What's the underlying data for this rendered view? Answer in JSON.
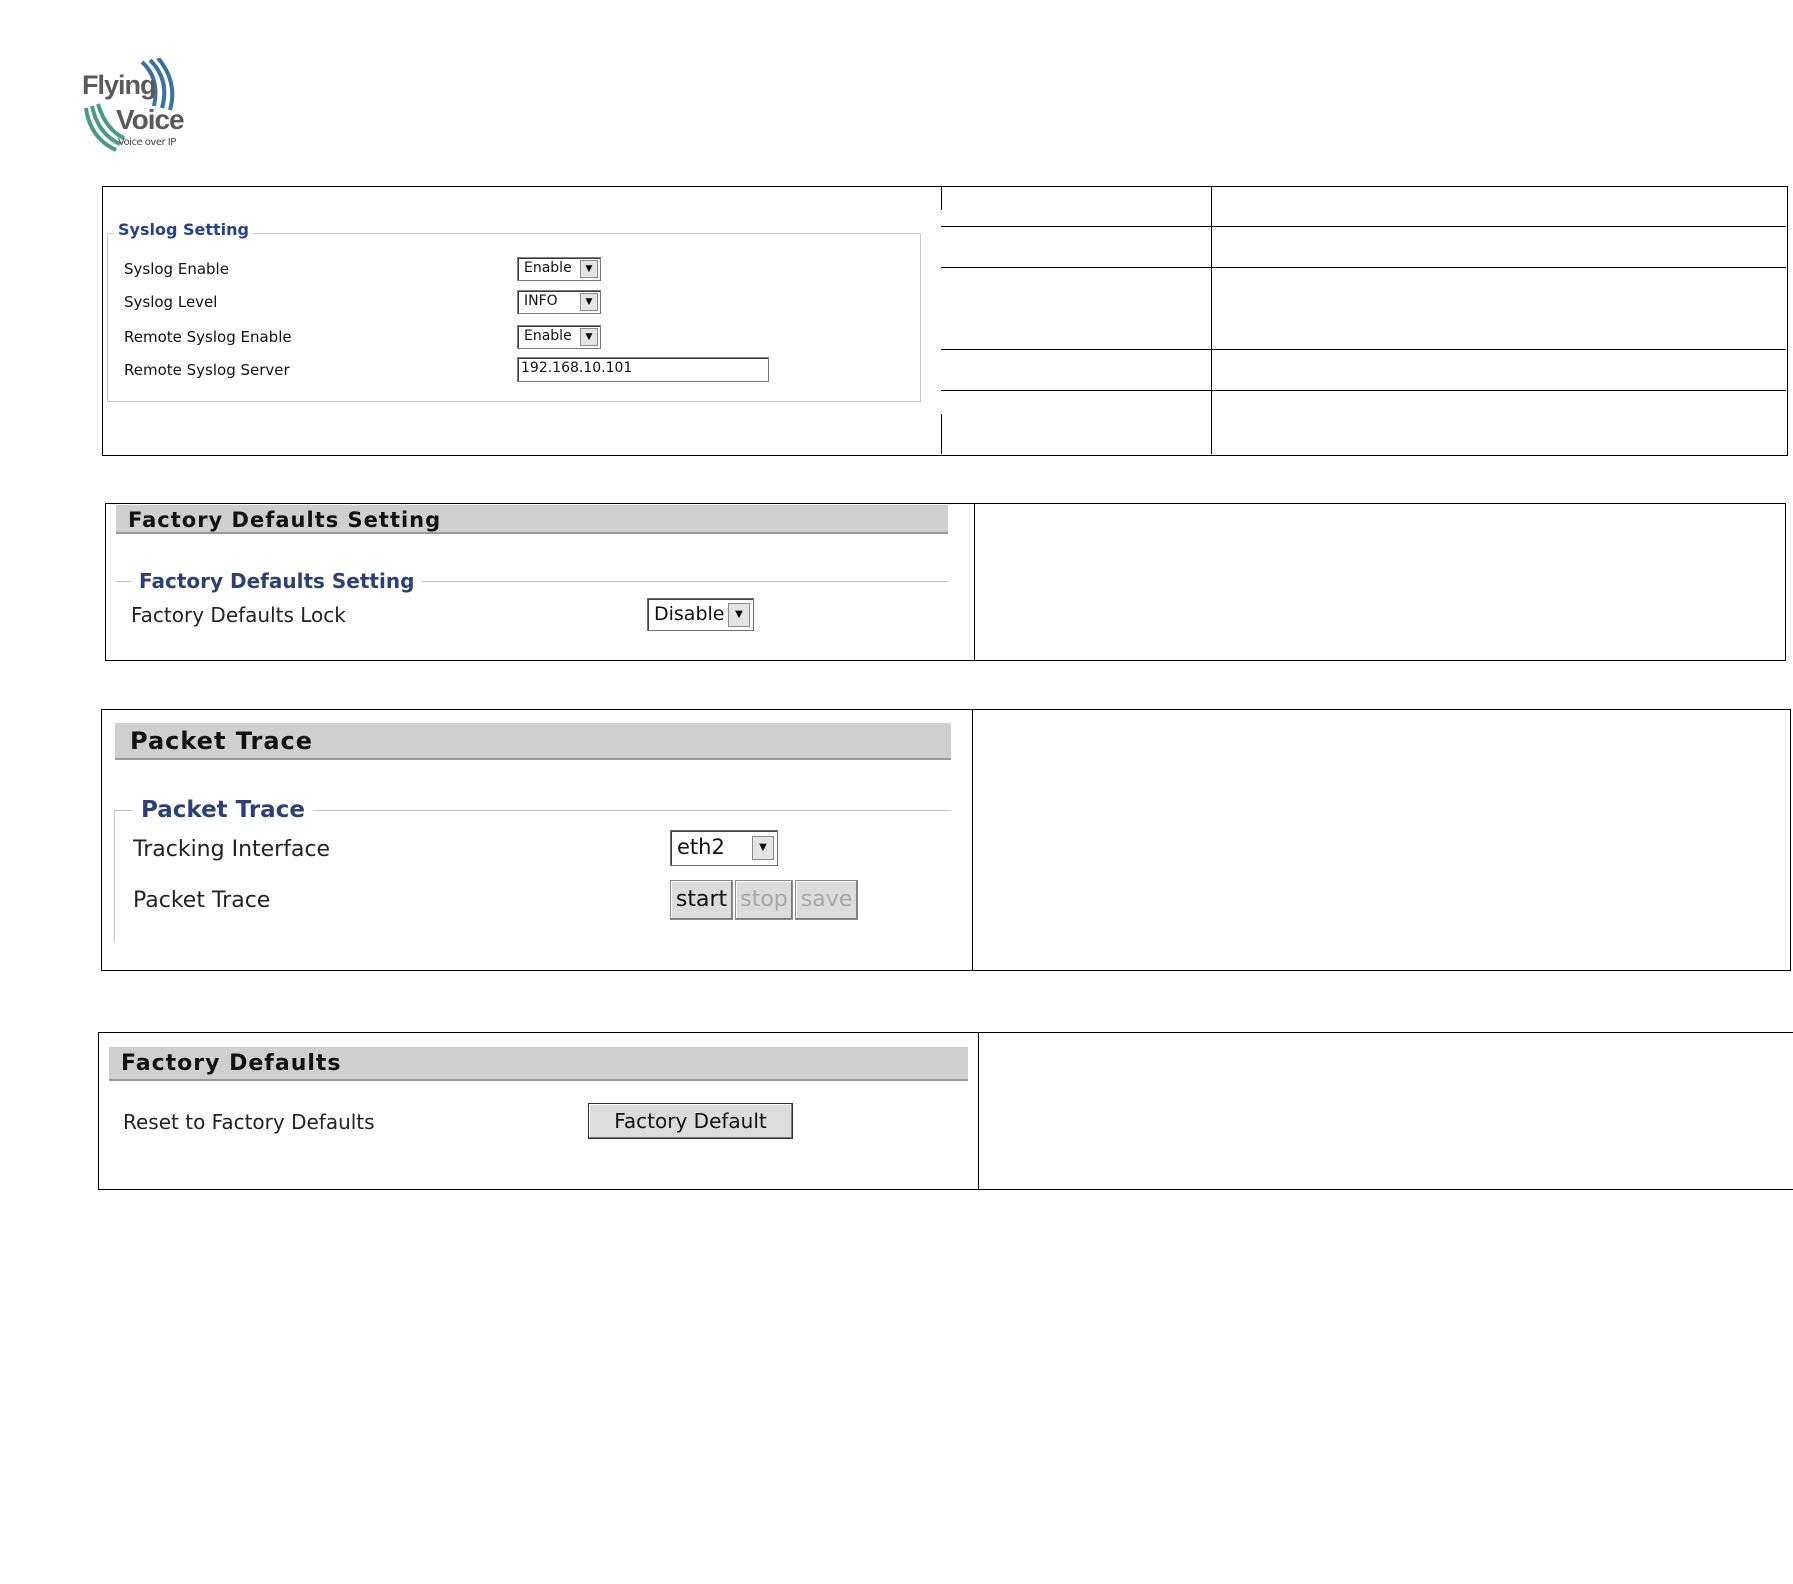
{
  "logo": {
    "line1": "Flying",
    "line2": "Voice",
    "tagline": "Voice over IP"
  },
  "syslog": {
    "legend": "Syslog Setting",
    "rows": [
      {
        "label": "Syslog Enable",
        "value": "Enable"
      },
      {
        "label": "Syslog Level",
        "value": "INFO"
      },
      {
        "label": "Remote Syslog Enable",
        "value": "Enable"
      },
      {
        "label": "Remote Syslog Server",
        "value": "192.168.10.101"
      }
    ]
  },
  "factory_settings": {
    "header": "Factory Defaults Setting",
    "legend": "Factory Defaults Setting",
    "lock_label": "Factory Defaults Lock",
    "lock_value": "Disable"
  },
  "packet_trace": {
    "header": "Packet Trace",
    "legend": "Packet Trace",
    "interface_label": "Tracking Interface",
    "interface_value": "eth2",
    "trace_label": "Packet Trace",
    "start_label": "start",
    "stop_label": "stop",
    "save_label": "save"
  },
  "factory_defaults": {
    "header": "Factory Defaults",
    "reset_label": "Reset to Factory Defaults",
    "button_label": "Factory Default"
  },
  "colors": {
    "legend": "#27408b",
    "header_bar": "#cfcfcf",
    "logo_wave": "#3a6fa8",
    "logo_gray": "#5a5a5a"
  }
}
